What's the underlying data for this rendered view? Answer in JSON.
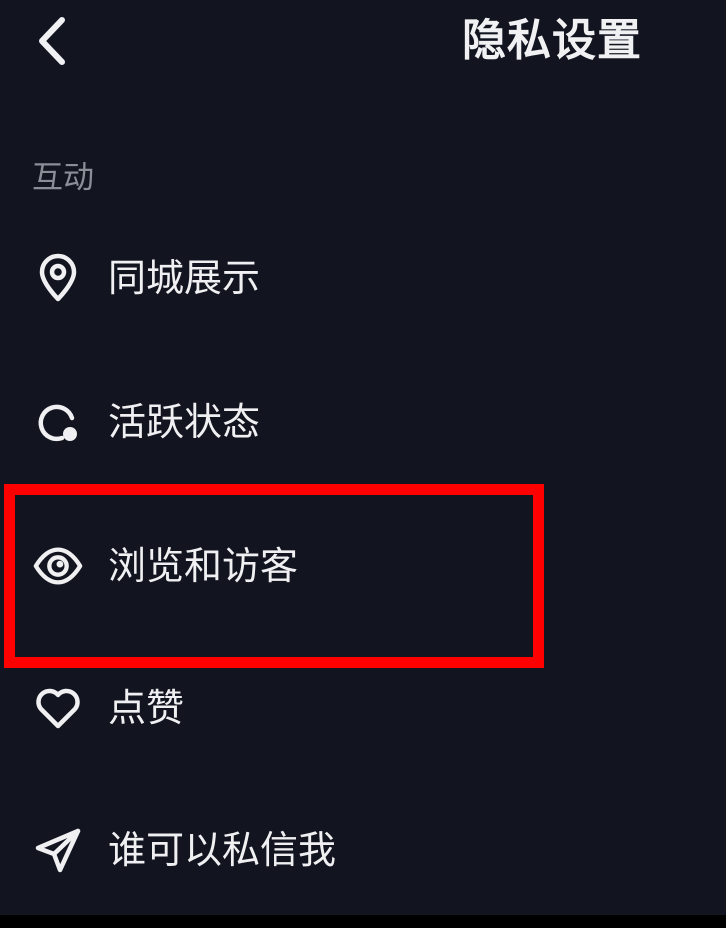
{
  "header": {
    "title": "隐私设置",
    "back_icon": "chevron-left-icon"
  },
  "section": {
    "label": "互动"
  },
  "menu": [
    {
      "label": "同城展示",
      "icon": "location-pin-icon"
    },
    {
      "label": "活跃状态",
      "icon": "activity-status-icon"
    },
    {
      "label": "浏览和访客",
      "icon": "eye-icon"
    },
    {
      "label": "点赞",
      "icon": "heart-icon"
    },
    {
      "label": "谁可以私信我",
      "icon": "send-icon"
    }
  ],
  "colors": {
    "background": "#121520",
    "text": "#f0f0f2",
    "section_text": "#8b8d97",
    "highlight": "#ff0000"
  }
}
